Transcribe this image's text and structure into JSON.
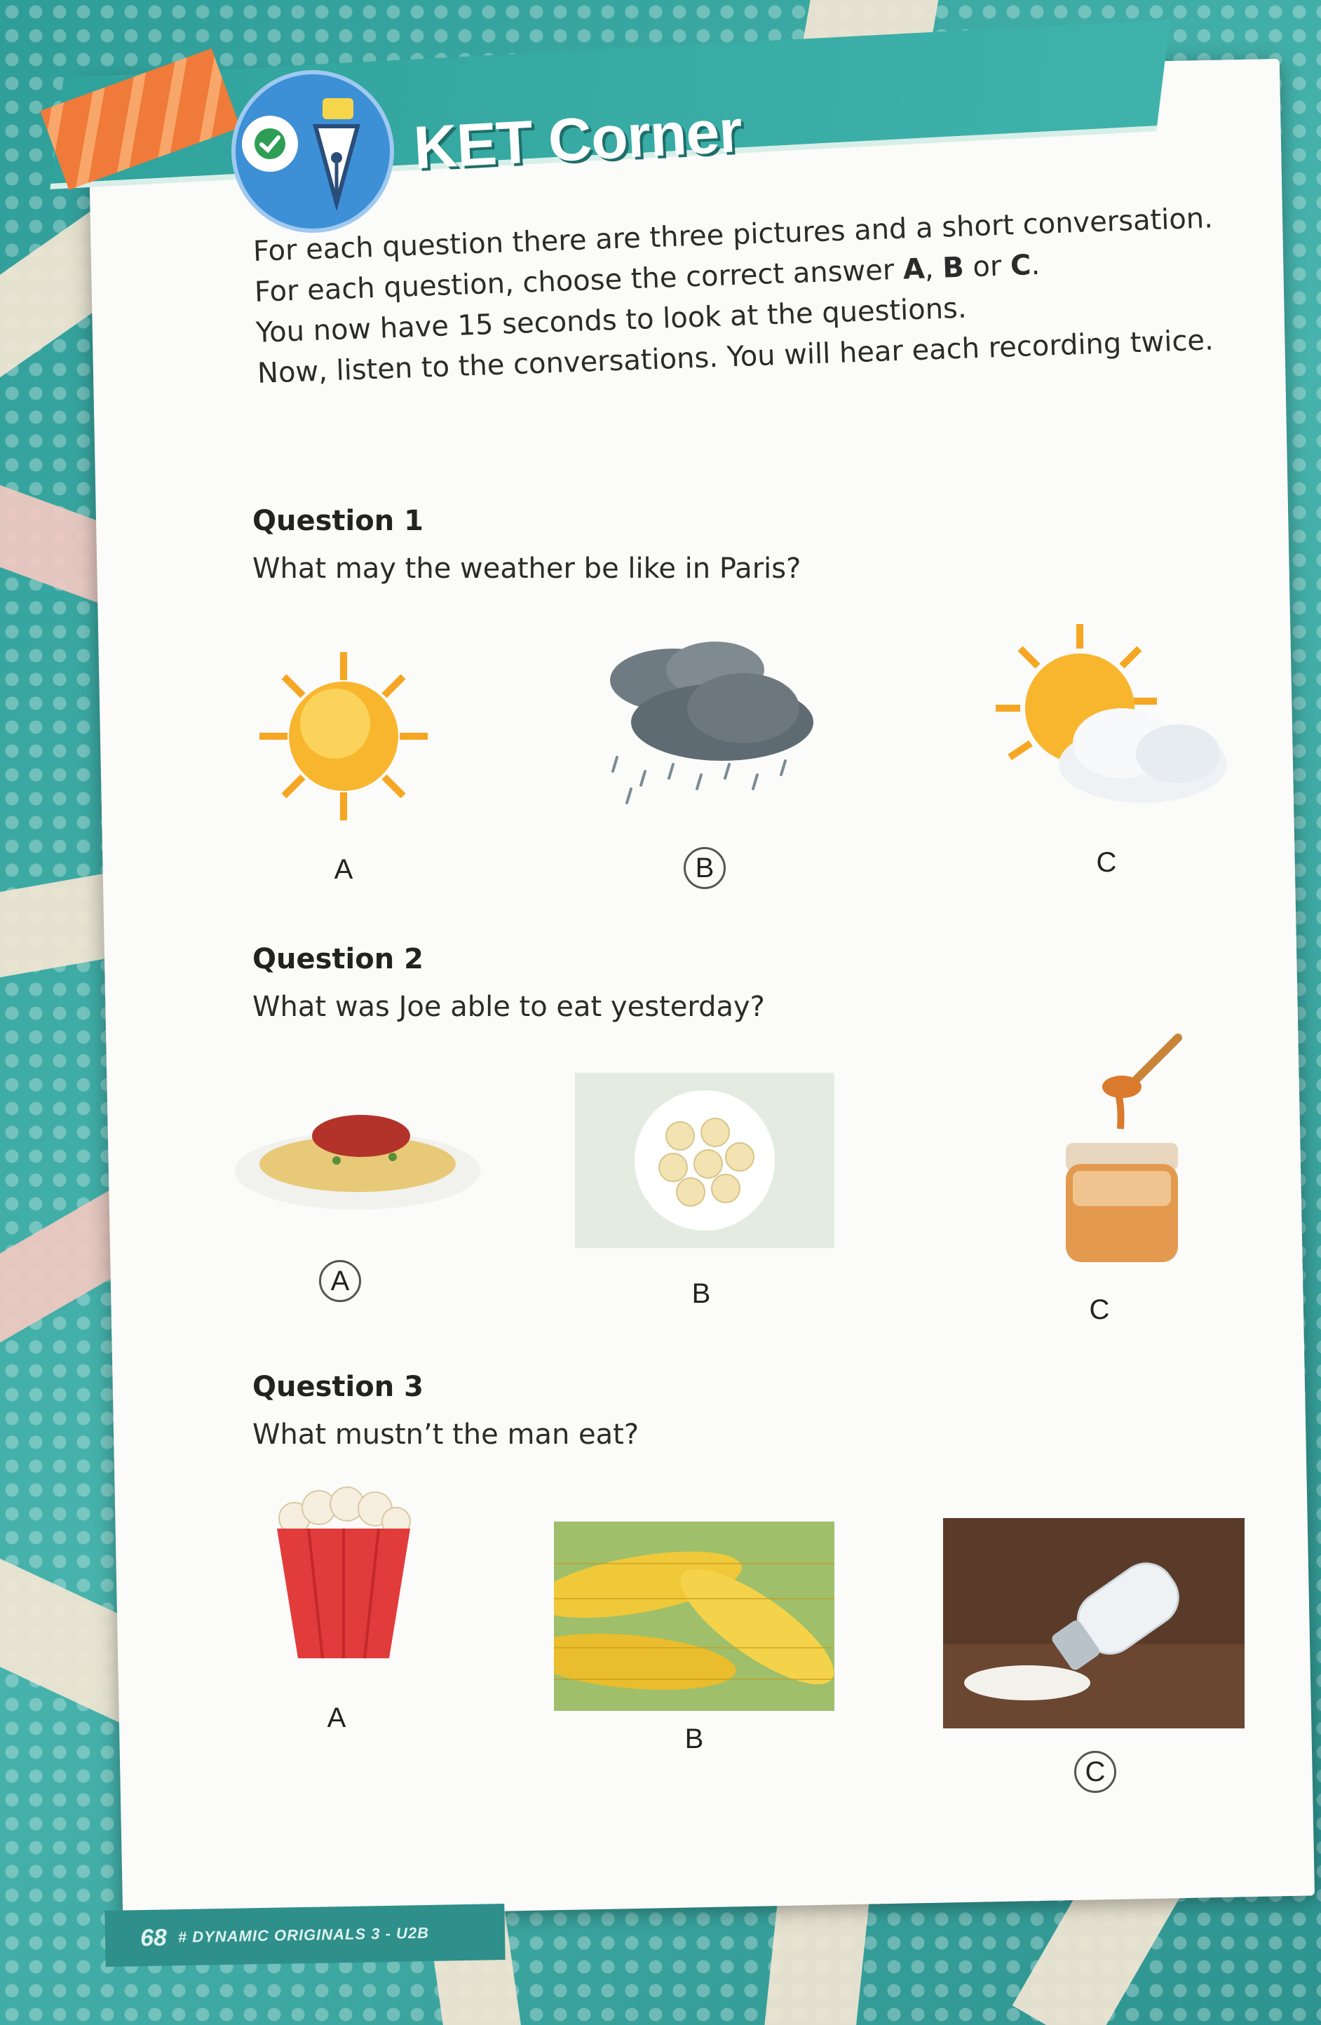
{
  "header": {
    "title": "KET Corner"
  },
  "instructions": {
    "line1_part1": "For each question there are three pictures and a short conversation. For each question, choose the correct answer ",
    "opt_a": "A",
    "comma": ", ",
    "opt_b": "B",
    "or": " or ",
    "opt_c": "C",
    "period": ".",
    "line2": "You now have 15 seconds to look at the questions.",
    "line3": "Now, listen to the conversations. You will hear each recording twice."
  },
  "questions": [
    {
      "title": "Question 1",
      "text": "What may the weather be like in Paris?",
      "options": [
        {
          "label": "A",
          "picture": "sun-icon",
          "circled": false
        },
        {
          "label": "B",
          "picture": "rain-cloud-icon",
          "circled": true
        },
        {
          "label": "C",
          "picture": "sun-behind-cloud-icon",
          "circled": false
        }
      ]
    },
    {
      "title": "Question 2",
      "text": "What was Joe able to eat yesterday?",
      "options": [
        {
          "label": "A",
          "picture": "spaghetti-icon",
          "circled": true
        },
        {
          "label": "B",
          "picture": "banana-slices-icon",
          "circled": false
        },
        {
          "label": "C",
          "picture": "honey-jar-icon",
          "circled": false
        }
      ]
    },
    {
      "title": "Question 3",
      "text": "What mustn’t the man eat?",
      "options": [
        {
          "label": "A",
          "picture": "popcorn-icon",
          "circled": false
        },
        {
          "label": "B",
          "picture": "corn-icon",
          "circled": false
        },
        {
          "label": "C",
          "picture": "salt-shaker-icon",
          "circled": true
        }
      ]
    }
  ],
  "footer": {
    "page_number": "68",
    "book_title": "# DYNAMIC ORIGINALS 3 - U2B"
  }
}
